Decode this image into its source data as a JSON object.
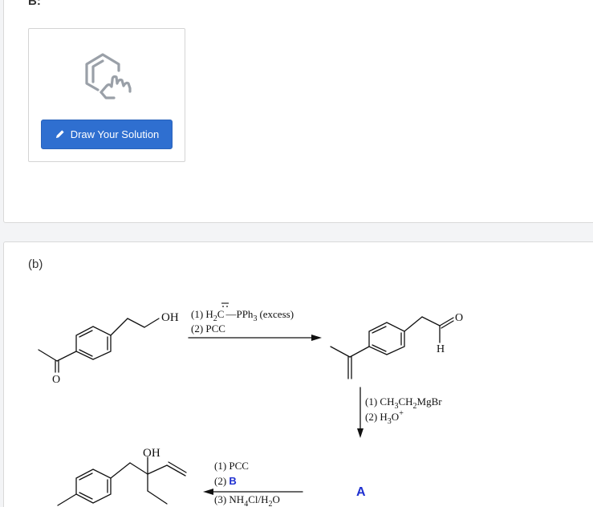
{
  "part_a": {
    "label": "B:",
    "button_label": "Draw Your Solution",
    "icons": {
      "molecule": "molecule-drawing-icon",
      "pencil": "pencil-icon"
    }
  },
  "part_b": {
    "label": "(b)",
    "start_oh": "OH",
    "step1_reagent1_prefix": "(1) H",
    "step1_reagent1_sub": "2",
    "step1_reagent1_c": "C",
    "step1_reagent1_suffix": "PPh",
    "step1_reagent1_sub2": "3",
    "step1_reagent1_excess": "(excess)",
    "step1_reagent2": "(2) PCC",
    "aldehyde_o": "O",
    "aldehyde_h": "H",
    "ketone_o": "O",
    "step2_reagent1": "(1) CH",
    "step2_reagent1_b": "CH",
    "step2_reagent1_c": "MgBr",
    "step2_sub": "3",
    "step2_sub2": "2",
    "step2_reagent2": "(2) H",
    "step2_reagent2_o": "O",
    "step2_reagent2_sup": "+",
    "intermediate_a": "A",
    "product_oh": "OH",
    "step3_reagent1": "(1) PCC",
    "step3_reagent2_num": "(2) ",
    "step3_reagent2_b": "B",
    "step3_reagent3": "(3) NH",
    "step3_reagent3_sub": "4",
    "step3_reagent3_cl": "Cl/H",
    "step3_reagent3_sub2": "2",
    "step3_reagent3_o": "O",
    "accent_color": "#1e2fd0"
  }
}
